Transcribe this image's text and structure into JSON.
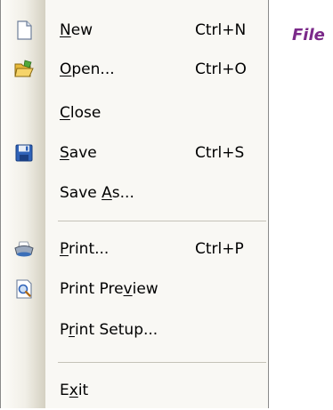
{
  "title": "File",
  "menu": {
    "items": [
      {
        "key": "new",
        "pre": "",
        "accel": "N",
        "post": "ew",
        "shortcut": "Ctrl+N",
        "icon": "new-document-icon"
      },
      {
        "key": "open",
        "pre": "",
        "accel": "O",
        "post": "pen...",
        "shortcut": "Ctrl+O",
        "icon": "open-folder-icon"
      },
      {
        "key": "close",
        "pre": "",
        "accel": "C",
        "post": "lose",
        "shortcut": "",
        "icon": ""
      },
      {
        "key": "save",
        "pre": "",
        "accel": "S",
        "post": "ave",
        "shortcut": "Ctrl+S",
        "icon": "floppy-disk-icon"
      },
      {
        "key": "save-as",
        "pre": "Save ",
        "accel": "A",
        "post": "s...",
        "shortcut": "",
        "icon": ""
      },
      {
        "key": "print",
        "pre": "",
        "accel": "P",
        "post": "rint...",
        "shortcut": "Ctrl+P",
        "icon": "printer-icon"
      },
      {
        "key": "print-preview",
        "pre": "Print Pre",
        "accel": "v",
        "post": "iew",
        "shortcut": "",
        "icon": "print-preview-icon"
      },
      {
        "key": "print-setup",
        "pre": "P",
        "accel": "r",
        "post": "int Setup...",
        "shortcut": "",
        "icon": ""
      },
      {
        "key": "exit",
        "pre": "E",
        "accel": "x",
        "post": "it",
        "shortcut": "",
        "icon": ""
      }
    ]
  }
}
